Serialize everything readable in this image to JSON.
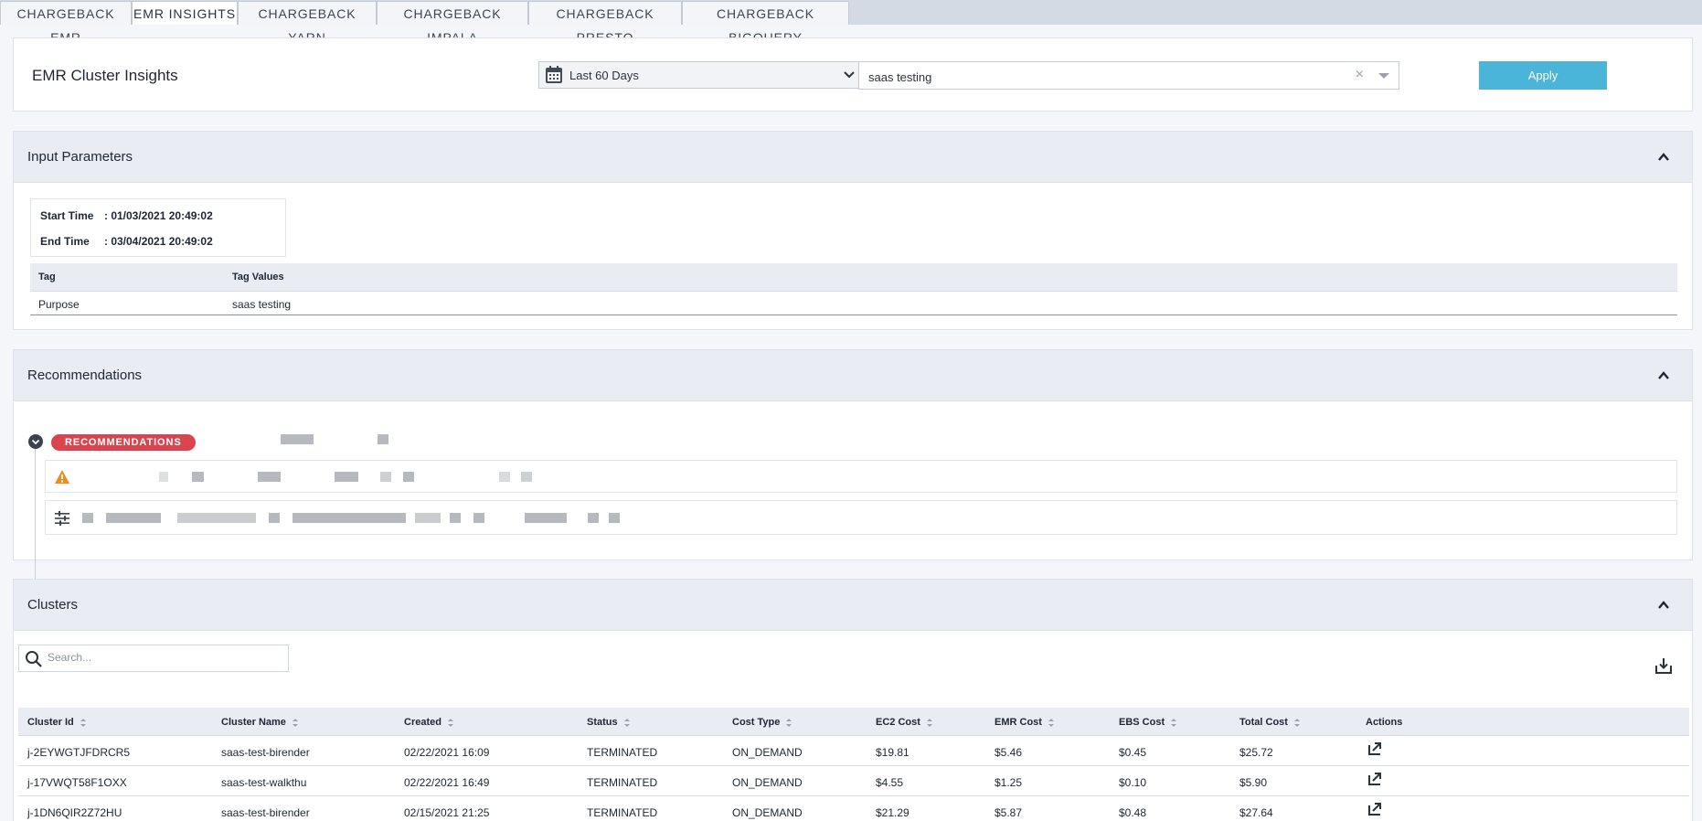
{
  "tabs": [
    {
      "label": "CHARGEBACK EMR",
      "active": false
    },
    {
      "label": "EMR INSIGHTS",
      "active": true
    },
    {
      "label": "CHARGEBACK YARN",
      "active": false
    },
    {
      "label": "CHARGEBACK IMPALA",
      "active": false
    },
    {
      "label": "CHARGEBACK PRESTO",
      "active": false
    },
    {
      "label": "CHARGEBACK BIGQUERY",
      "active": false
    }
  ],
  "header": {
    "title": "EMR Cluster Insights",
    "date_range": "Last 60 Days",
    "tag_filter": "saas testing",
    "apply_label": "Apply"
  },
  "input_parameters": {
    "title": "Input Parameters",
    "start_label": "Start Time",
    "start_value": ": 01/03/2021 20:49:02",
    "end_label": "End Time",
    "end_value": ": 03/04/2021 20:49:02",
    "tag_header": "Tag",
    "tag_values_header": "Tag Values",
    "tag": "Purpose",
    "tag_value": "saas testing"
  },
  "recommendations": {
    "title": "Recommendations",
    "badge": "RECOMMENDATIONS"
  },
  "clusters": {
    "title": "Clusters",
    "search_placeholder": "Search...",
    "columns": [
      "Cluster Id",
      "Cluster Name",
      "Created",
      "Status",
      "Cost Type",
      "EC2 Cost",
      "EMR Cost",
      "EBS Cost",
      "Total Cost",
      "Actions"
    ],
    "rows": [
      [
        "j-2EYWGTJFDRCR5",
        "saas-test-birender",
        "02/22/2021 16:09",
        "TERMINATED",
        "ON_DEMAND",
        "$19.81",
        "$5.46",
        "$0.45",
        "$25.72"
      ],
      [
        "j-17VWQT58F1OXX",
        "saas-test-walkthu",
        "02/22/2021 16:49",
        "TERMINATED",
        "ON_DEMAND",
        "$4.55",
        "$1.25",
        "$0.10",
        "$5.90"
      ],
      [
        "j-1DN6QIR2Z72HU",
        "saas-test-birender",
        "02/15/2021 21:25",
        "TERMINATED",
        "ON_DEMAND",
        "$21.29",
        "$5.87",
        "$0.48",
        "$27.64"
      ]
    ]
  },
  "colors": {
    "accent": "#4bb5d9",
    "badge": "#d9444e",
    "warning": "#f08c1a"
  }
}
